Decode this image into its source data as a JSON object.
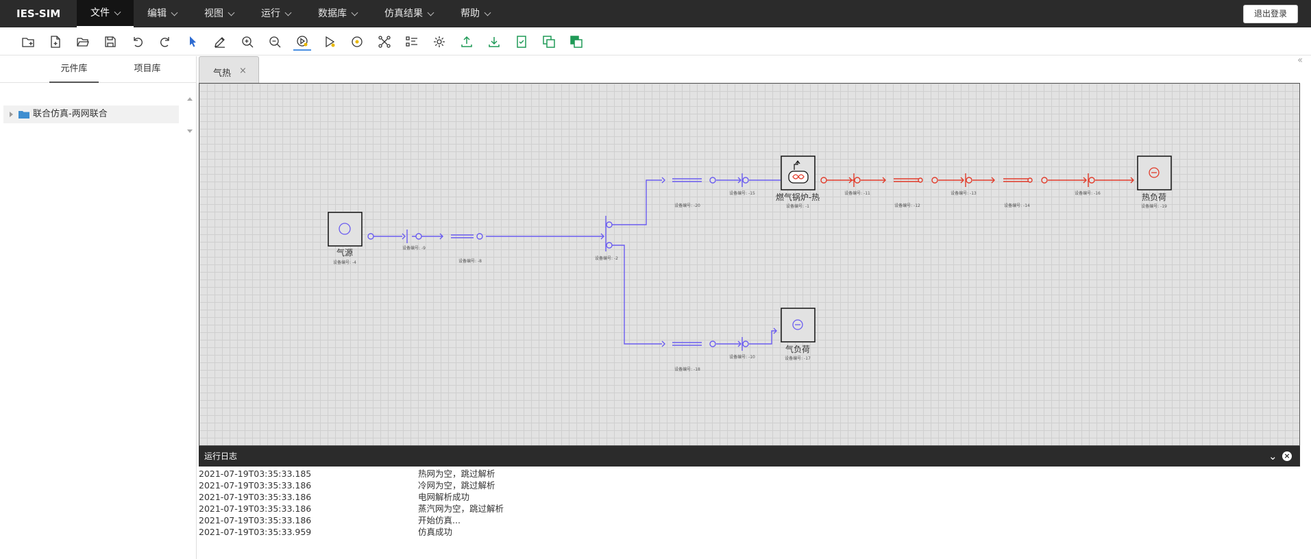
{
  "app": {
    "title": "IES-SIM"
  },
  "menu": [
    {
      "label": "文件"
    },
    {
      "label": "编辑"
    },
    {
      "label": "视图"
    },
    {
      "label": "运行"
    },
    {
      "label": "数据库"
    },
    {
      "label": "仿真结果"
    },
    {
      "label": "帮助"
    }
  ],
  "header": {
    "logout_label": "退出登录"
  },
  "toolbar": {
    "tools": [
      "new-project-icon",
      "new-file-icon",
      "open-folder-icon",
      "save-icon",
      "undo-icon",
      "redo-icon",
      "select-pointer-icon",
      "edit-pencil-icon",
      "zoom-in-icon",
      "zoom-out-icon",
      "run-check-icon",
      "run-step-icon",
      "target-icon",
      "topology-icon",
      "list-settings-icon",
      "settings-gear-icon",
      "upload-icon",
      "download-icon",
      "report-check-icon",
      "copy-layer-icon",
      "paste-layer-icon"
    ],
    "accent": "#2d6bd1"
  },
  "sidebar": {
    "tabs": [
      {
        "label": "元件库"
      },
      {
        "label": "项目库"
      }
    ],
    "tree": [
      {
        "label": "联合仿真-两网联合"
      }
    ]
  },
  "editor": {
    "tab": {
      "label": "气热",
      "close": "×"
    }
  },
  "diagram": {
    "nodes": {
      "gas_source": {
        "label": "气源",
        "id": "设备编号: -4"
      },
      "boiler": {
        "label": "燃气锅炉-热",
        "id": "设备编号: -1"
      },
      "heat_load": {
        "label": "热负荷",
        "id": "设备编号: -19"
      },
      "gas_load": {
        "label": "气负荷",
        "id": "设备编号: -17"
      }
    },
    "small_ids": [
      "设备编号: -9",
      "设备编号: -8",
      "设备编号: -2",
      "设备编号: -20",
      "设备编号: -15",
      "设备编号: -11",
      "设备编号: -12",
      "设备编号: -13",
      "设备编号: -14",
      "设备编号: -16",
      "设备编号: -18",
      "设备编号: -10"
    ],
    "colors": {
      "gas": "#6a5cf0",
      "heat": "#e13b2a"
    }
  },
  "log": {
    "title": "运行日志",
    "entries": [
      {
        "time": "2021-07-19T03:35:33.185",
        "msg": "热网为空，跳过解析"
      },
      {
        "time": "2021-07-19T03:35:33.186",
        "msg": "冷网为空，跳过解析"
      },
      {
        "time": "2021-07-19T03:35:33.186",
        "msg": "电网解析成功"
      },
      {
        "time": "2021-07-19T03:35:33.186",
        "msg": "蒸汽网为空，跳过解析"
      },
      {
        "time": "2021-07-19T03:35:33.186",
        "msg": "开始仿真..."
      },
      {
        "time": "2021-07-19T03:35:33.959",
        "msg": "仿真成功"
      }
    ]
  }
}
